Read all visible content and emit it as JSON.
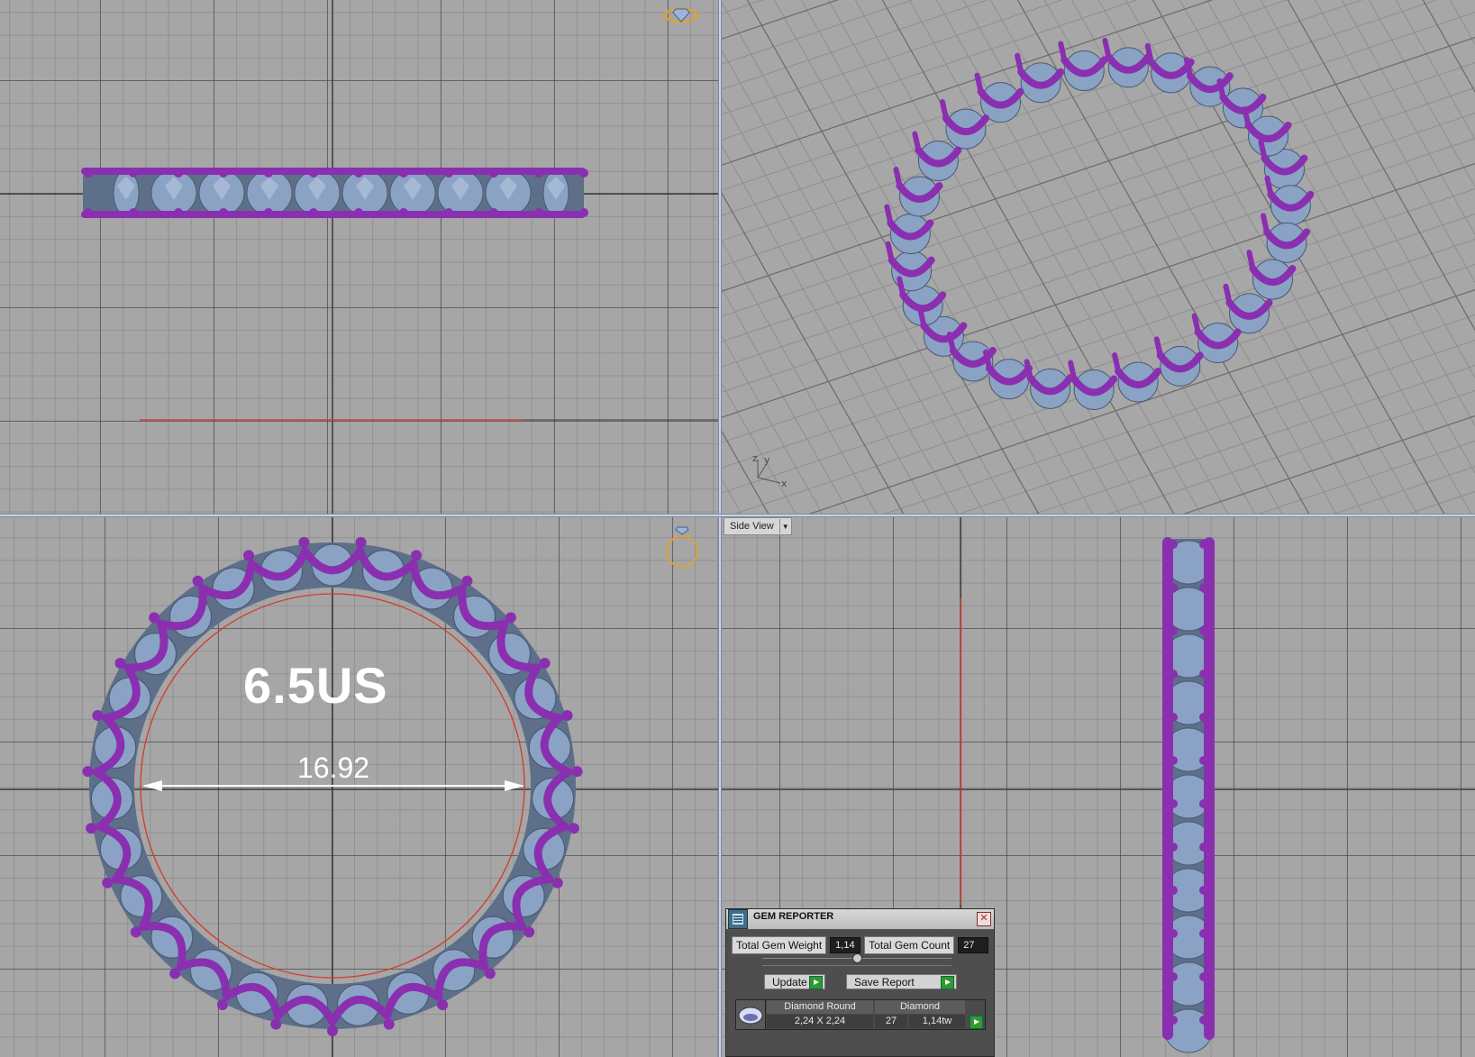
{
  "viewports": {
    "side_view_label": "Side View"
  },
  "front_view": {
    "ring_size": "6.5US",
    "inner_diameter": "16.92"
  },
  "axes": {
    "z": "z",
    "y": "y",
    "x": "x"
  },
  "gem_reporter": {
    "title": "GEM REPORTER",
    "total_weight_label": "Total Gem Weight",
    "total_weight_value": "1,14",
    "total_count_label": "Total Gem Count",
    "total_count_value": "27",
    "update_label": "Update",
    "save_report_label": "Save Report",
    "table": {
      "headers": [
        "Diamond Round",
        "Diamond"
      ],
      "row": {
        "size": "2,24 X 2,24",
        "count": "27",
        "weight": "1,14tw"
      }
    }
  },
  "colors": {
    "metal": "#8a2fb0",
    "gem": "#8aa3c4",
    "grid_bg": "#a6a6a6",
    "dimension_line": "#ffffff",
    "axis_red": "#d43a2a",
    "gizmo": "#e0a030"
  }
}
